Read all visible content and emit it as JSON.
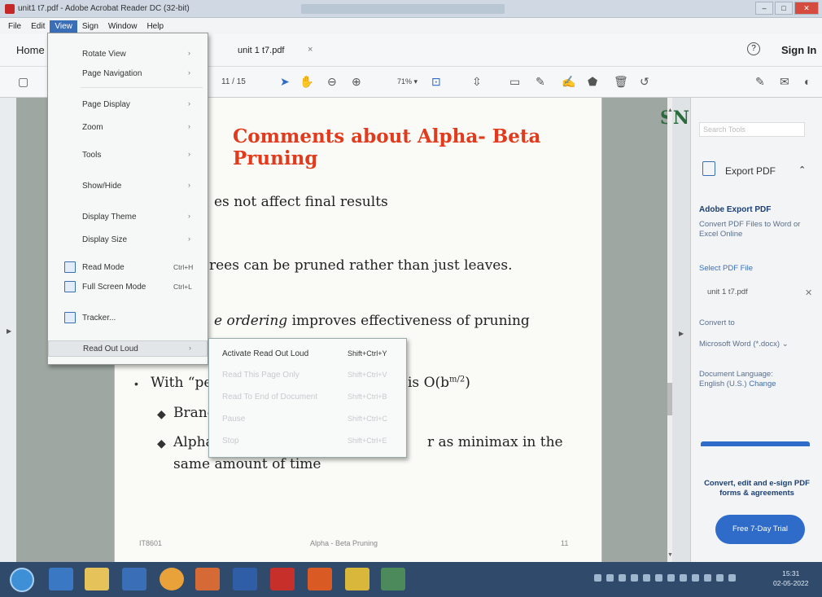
{
  "window": {
    "title": "unit1 t7.pdf - Adobe Acrobat Reader DC (32-bit)"
  },
  "menubar": [
    "File",
    "Edit",
    "View",
    "Sign",
    "Window",
    "Help"
  ],
  "tabs": {
    "home": "Home",
    "doc": "unit 1 t7.pdf",
    "close": "×",
    "signin": "Sign In",
    "help": "?"
  },
  "toolbar": {
    "page_current": "11",
    "page_total": "/ 15",
    "zoom": "71%"
  },
  "slide": {
    "title": "Comments about Alpha- Beta Pruning",
    "logo": "SNS",
    "line1": "es not affect final results",
    "line2": "rees can be pruned rather than just leaves.",
    "line3_em": "e ordering",
    "line3_rest": " improves effectiveness of pruning",
    "line4": "With “perf",
    "line4_end": "is O(b",
    "line4_sup": "m/2",
    "line4_close": ")",
    "line5": "Branch",
    "line6": "Alpha-b",
    "line6_end": "r as minimax in the",
    "line7": "same amount of time",
    "footer_left": "IT8601",
    "footer_center": "Alpha - Beta Pruning",
    "footer_right": "11"
  },
  "view_menu": {
    "items": [
      {
        "label": "Rotate View",
        "submenu": true
      },
      {
        "label": "Page Navigation",
        "submenu": true
      },
      {
        "label": "Page Display",
        "submenu": true
      },
      {
        "label": "Zoom",
        "submenu": true
      },
      {
        "label": "Tools",
        "submenu": true
      },
      {
        "label": "Show/Hide",
        "submenu": true
      },
      {
        "label": "Display Theme",
        "submenu": true
      },
      {
        "label": "Display Size",
        "submenu": true
      },
      {
        "label": "Read Mode",
        "shortcut": "Ctrl+H"
      },
      {
        "label": "Full Screen Mode",
        "shortcut": "Ctrl+L"
      },
      {
        "label": "Tracker..."
      },
      {
        "label": "Read Out Loud",
        "submenu": true
      }
    ]
  },
  "read_out_loud_menu": {
    "items": [
      {
        "label": "Activate Read Out Loud",
        "shortcut": "Shift+Ctrl+Y",
        "enabled": true
      },
      {
        "label": "Read This Page Only",
        "shortcut": "Shift+Ctrl+V",
        "enabled": false
      },
      {
        "label": "Read To End of Document",
        "shortcut": "Shift+Ctrl+B",
        "enabled": false
      },
      {
        "label": "Pause",
        "shortcut": "Shift+Ctrl+C",
        "enabled": false
      },
      {
        "label": "Stop",
        "shortcut": "Shift+Ctrl+E",
        "enabled": false
      }
    ]
  },
  "right_pane": {
    "search_placeholder": "Search Tools",
    "export_title": "Export PDF",
    "heading": "Adobe Export PDF",
    "desc": "Convert PDF Files to Word or Excel Online",
    "select_file": "Select PDF File",
    "file_name": "unit 1 t7.pdf",
    "convert_to": "Convert to",
    "convert_value": "Microsoft Word (*.docx)",
    "doc_lang_label": "Document Language:",
    "doc_lang_value": "English (U.S.)",
    "change": "Change",
    "promo": "Convert, edit and e-sign PDF forms & agreements",
    "trial_button": "Free 7-Day Trial"
  },
  "taskbar": {
    "time": "15:31",
    "date": "02-05-2022"
  },
  "colors": {
    "title_red": "#e13a1c",
    "accent_blue": "#2f6bc9",
    "taskbar": "#2f4a6a"
  }
}
